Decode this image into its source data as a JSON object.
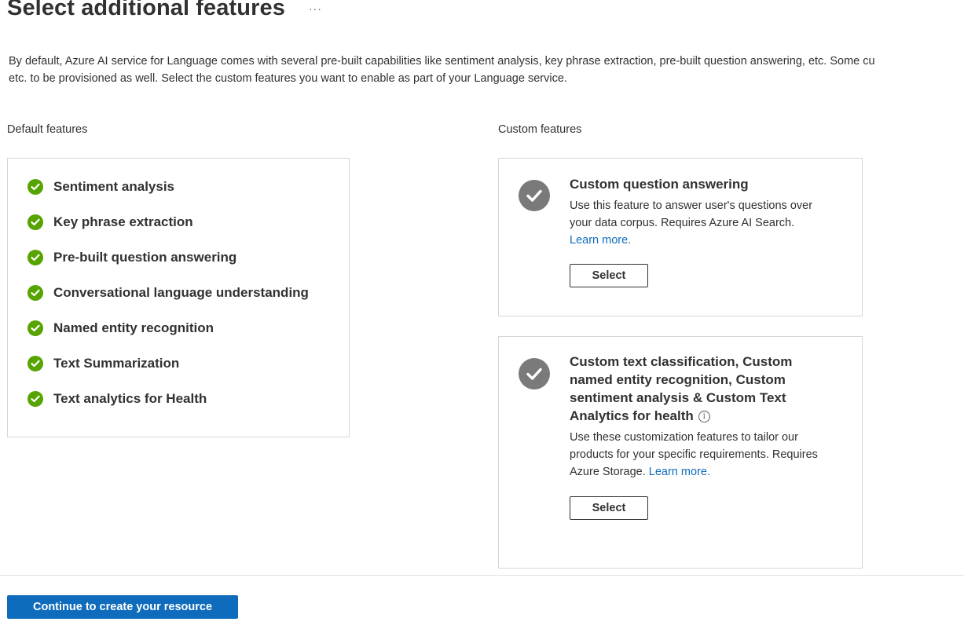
{
  "header": {
    "title": "Select additional features",
    "more_label": "···"
  },
  "description": {
    "line1": "By default, Azure AI service for Language comes with several pre-built capabilities like sentiment analysis, key phrase extraction, pre-built question answering, etc. Some cu",
    "line2": "etc. to be provisioned as well. Select the custom features you want to enable as part of your Language service."
  },
  "default_features": {
    "label": "Default features",
    "icon": "green-checkmark-icon",
    "check_color": "#57a300",
    "items": [
      {
        "label": "Sentiment analysis"
      },
      {
        "label": "Key phrase extraction"
      },
      {
        "label": "Pre-built question answering"
      },
      {
        "label": "Conversational language understanding"
      },
      {
        "label": "Named entity recognition"
      },
      {
        "label": "Text Summarization"
      },
      {
        "label": "Text analytics for Health"
      }
    ]
  },
  "custom_features": {
    "label": "Custom features",
    "cards": [
      {
        "title": "Custom question answering",
        "description": "Use this feature to answer user's questions over your data corpus. Requires Azure AI Search.",
        "link_label": "Learn more.",
        "select_label": "Select",
        "icon": "gray-checkmark-icon"
      },
      {
        "title": "Custom text classification, Custom named entity recognition, Custom sentiment analysis & Custom Text Analytics for health",
        "info_icon": "info-icon",
        "description": "Use these customization features to tailor our products for your specific requirements. Requires Azure Storage.",
        "link_label": "Learn more.",
        "select_label": "Select",
        "icon": "gray-checkmark-icon"
      }
    ]
  },
  "footer": {
    "primary_label": "Continue to create your resource",
    "primary_color": "#0f6cbd"
  }
}
